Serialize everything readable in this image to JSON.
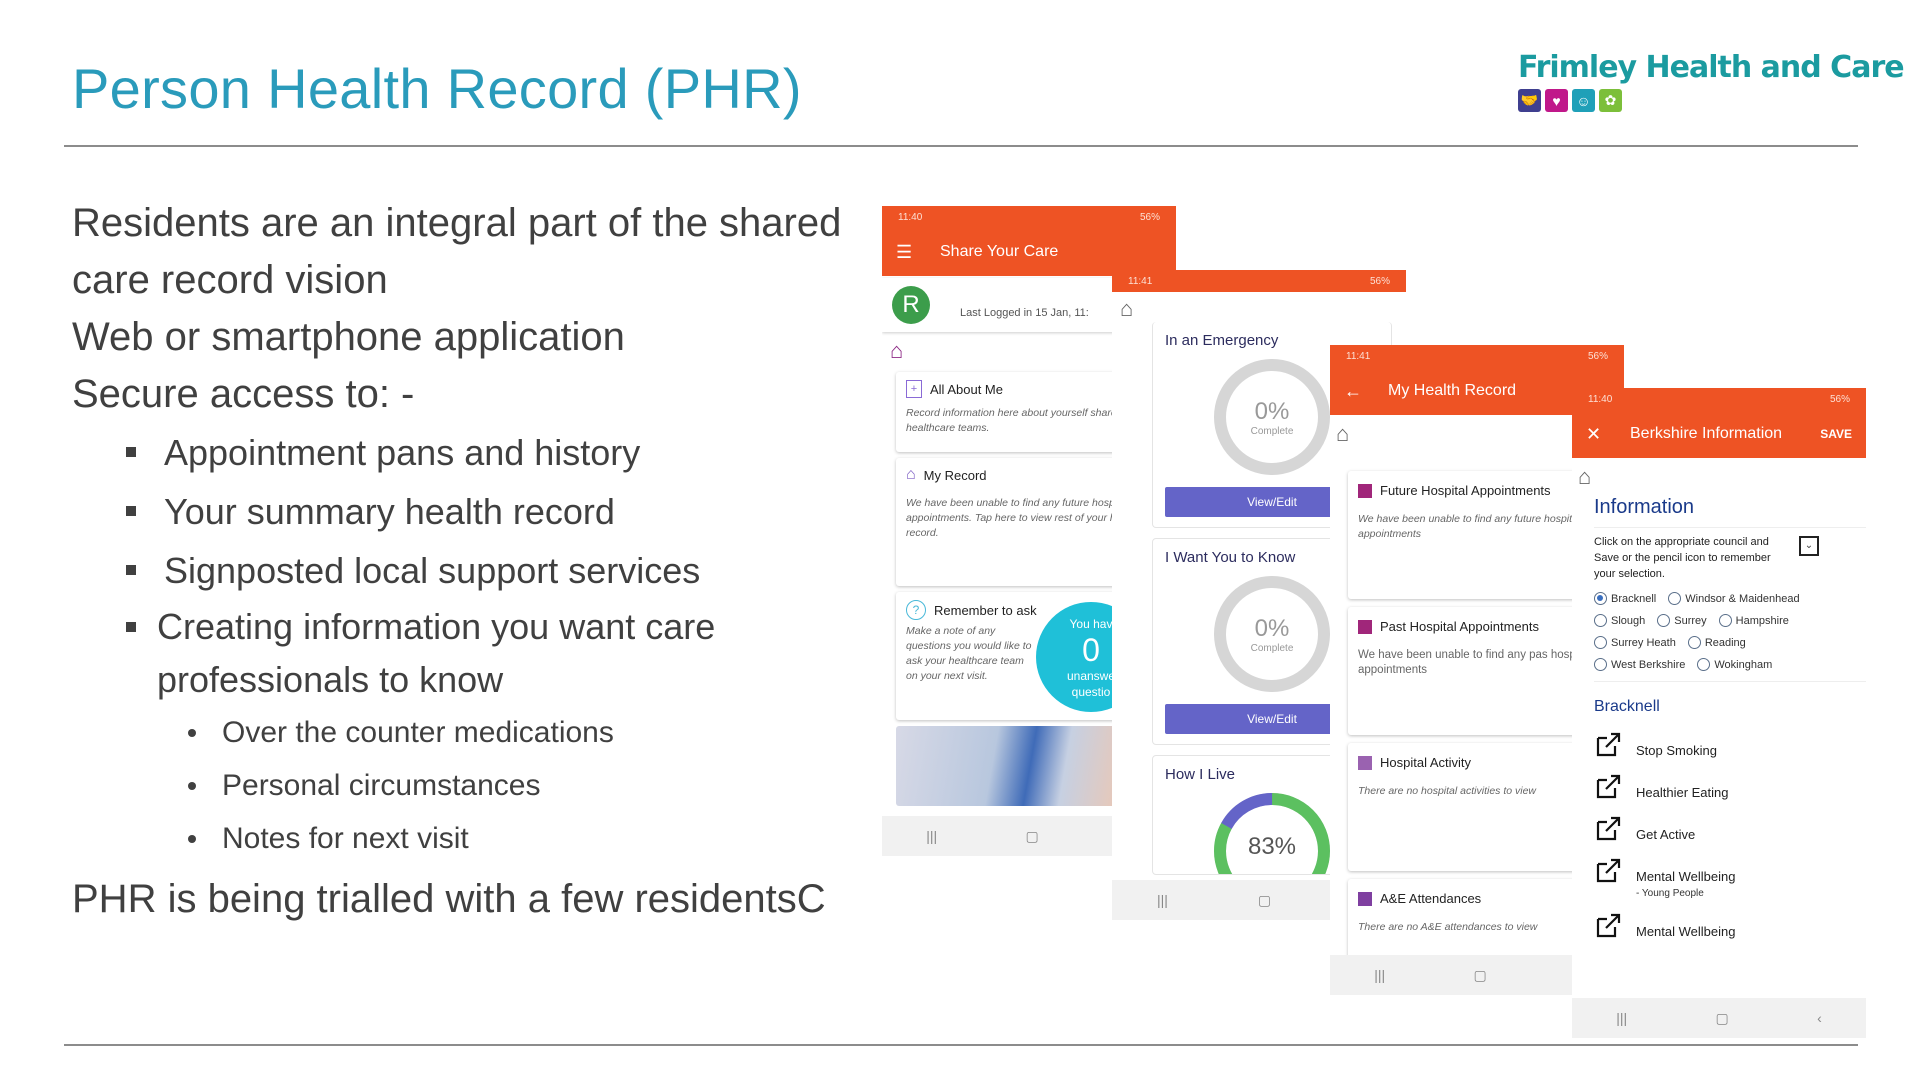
{
  "slide": {
    "title": "Person Health Record (PHR)",
    "colors": {
      "title": "#2a9bbb",
      "app_header": "#ee5324",
      "button": "#6464c8",
      "logo_text": "#1b9ba0"
    }
  },
  "logo": {
    "text": "Frimley Health and Care",
    "icons": [
      {
        "name": "handshake-icon",
        "color": "#3f3f8f",
        "glyph": "🤝"
      },
      {
        "name": "heart-pulse-icon",
        "color": "#c0188a",
        "glyph": "♥"
      },
      {
        "name": "person-icon",
        "color": "#1fa0b8",
        "glyph": "☺"
      },
      {
        "name": "hand-coins-icon",
        "color": "#7cbf3a",
        "glyph": "✿"
      }
    ]
  },
  "content": {
    "paragraphs": [
      "Residents are an integral part of the shared care record vision",
      "Web or smartphone application",
      "Secure access to: -"
    ],
    "bullets": [
      "Appointment pans and history",
      "Your summary health record",
      "Signposted local support services",
      "Creating information you want care professionals to know"
    ],
    "sub_bullets": [
      "Over the counter medications",
      "Personal circumstances",
      "Notes for next visit"
    ],
    "closing": "PHR is being trialled with a few residentsC"
  },
  "phone1": {
    "status_time": "11:40",
    "status_right": "56%",
    "app_title": "Share Your Care",
    "avatar_letter": "R",
    "last_logged_prefix": "Last Logged in ",
    "last_logged_value": "15 Jan, 11:",
    "cards": [
      {
        "title": "All About Me",
        "desc": "Record information here about yourself share with your healthcare teams."
      },
      {
        "title": "My Record",
        "desc": "We have been unable to find any future hospital appointments. Tap here to view rest of your health record."
      },
      {
        "title": "Remember to ask",
        "desc": "Make a note of any questions you would like to ask your healthcare team on your next visit."
      }
    ],
    "questions_badge": {
      "top": "You hav",
      "count": "0",
      "line2": "unanswe",
      "line3": "questio"
    }
  },
  "phone2": {
    "status_time": "11:41",
    "status_right": "56%",
    "sections": [
      {
        "title": "In an Emergency",
        "percent": 0,
        "label": "0%",
        "sub": "Complete",
        "button": "View/Edit"
      },
      {
        "title": "I Want You to Know",
        "percent": 0,
        "label": "0%",
        "sub": "Complete",
        "button": "View/Edit"
      },
      {
        "title": "How I Live",
        "percent": 83,
        "label": "83%"
      }
    ]
  },
  "phone3": {
    "status_time": "11:41",
    "status_right": "56%",
    "app_title": "My Health Record",
    "cards": [
      {
        "title": "Future Hospital Appointments",
        "desc": "We have been unable to find any future hospital appointments",
        "color": "#a0267a"
      },
      {
        "title": "Past Hospital Appointments",
        "desc": "We have been unable to find any pas hospital appointments",
        "color": "#a0267a"
      },
      {
        "title": "Hospital Activity",
        "desc": "There are no hospital activities to view",
        "color": "#9a62b0"
      },
      {
        "title": "A&E Attendances",
        "desc": "There are no A&E attendances to view",
        "color": "#7f3fa0"
      }
    ]
  },
  "phone4": {
    "status_time": "11:40",
    "status_right": "56%",
    "app_title": "Berkshire Information",
    "save_label": "SAVE",
    "heading": "Information",
    "instructions": "Click on the appropriate council and Save or the pencil icon to remember your selection.",
    "councils": [
      [
        {
          "label": "Bracknell",
          "selected": true
        },
        {
          "label": "Windsor & Maidenhead",
          "selected": false
        }
      ],
      [
        {
          "label": "Slough",
          "selected": false
        },
        {
          "label": "Surrey",
          "selected": false
        },
        {
          "label": "Hampshire",
          "selected": false
        }
      ],
      [
        {
          "label": "Surrey Heath",
          "selected": false
        },
        {
          "label": "Reading",
          "selected": false
        }
      ],
      [
        {
          "label": "West Berkshire",
          "selected": false
        },
        {
          "label": "Wokingham",
          "selected": false
        }
      ]
    ],
    "section_title": "Bracknell",
    "links": [
      {
        "label": "Stop Smoking"
      },
      {
        "label": "Healthier Eating"
      },
      {
        "label": "Get Active"
      },
      {
        "label": "Mental Wellbeing",
        "sub": "- Young People"
      },
      {
        "label": "Mental Wellbeing"
      }
    ]
  },
  "navbar": {
    "recents": "|||",
    "home": "▢",
    "back": "‹"
  }
}
